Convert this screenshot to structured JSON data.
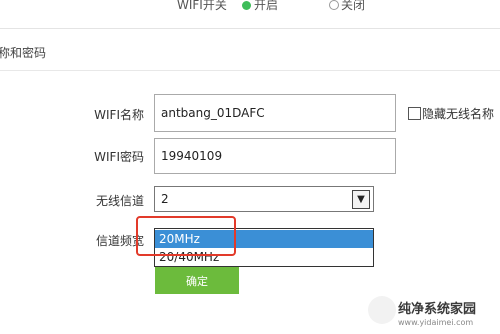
{
  "wifi_switch": {
    "label": "WIFI开关",
    "on_label": "开启",
    "off_label": "关闭",
    "selected": "开启"
  },
  "section_title": "名称和密码",
  "form": {
    "ssid_label": "WIFI名称",
    "ssid_value": "antbang_01DAFC",
    "hide_ssid_label": "隐藏无线名称",
    "password_label": "WIFI密码",
    "password_value": "19940109",
    "channel_label": "无线信道",
    "channel_value": "2",
    "bandwidth_label": "信道频宽",
    "bandwidth_options": [
      "20MHz",
      "20/40MHz"
    ],
    "bandwidth_selected": "20MHz",
    "confirm_label": "确定"
  },
  "watermark": {
    "text": "纯净系统家园",
    "url": "www.yidaimei.com"
  },
  "colors": {
    "accent_green": "#6cbb3c",
    "highlight": "#e23a2a",
    "selection_blue": "#3b8fd6"
  }
}
